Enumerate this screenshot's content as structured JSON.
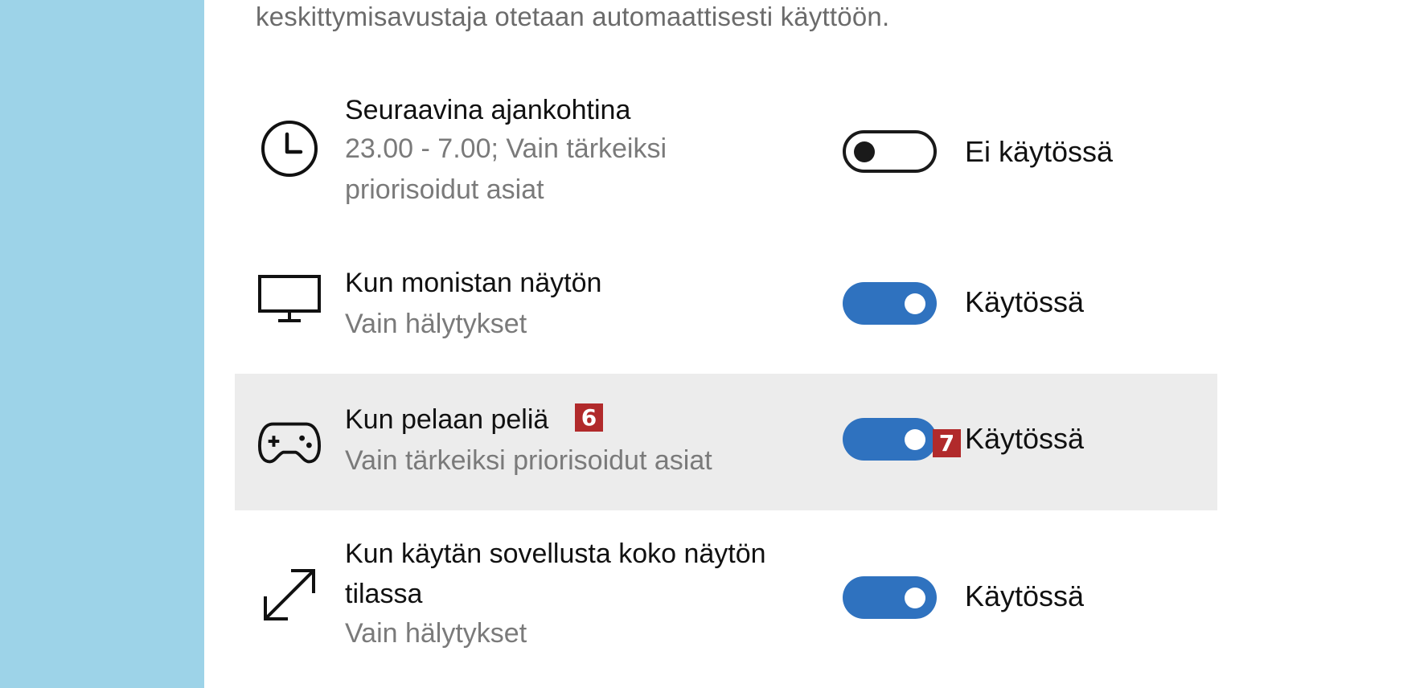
{
  "intro_text": "keskittymisavustaja otetaan automaattisesti käyttöön.",
  "colors": {
    "sidebar": "#9dd3e8",
    "toggle_on": "#2f72bf",
    "row_highlight": "#ececec",
    "badge": "#b12a2b"
  },
  "rules": [
    {
      "icon": "clock-icon",
      "title": "Seuraavina ajankohtina",
      "subtitle_line1": "23.00 - 7.00; Vain tärkeiksi",
      "subtitle_line2": "priorisoidut asiat",
      "toggle_on": false,
      "toggle_label": "Ei käytössä"
    },
    {
      "icon": "monitor-icon",
      "title": "Kun monistan näytön",
      "subtitle": "Vain hälytykset",
      "toggle_on": true,
      "toggle_label": "Käytössä"
    },
    {
      "icon": "gamepad-icon",
      "title": "Kun pelaan peliä",
      "subtitle": "Vain tärkeiksi priorisoidut asiat",
      "toggle_on": true,
      "toggle_label": "Käytössä",
      "highlighted": true
    },
    {
      "icon": "fullscreen-arrows-icon",
      "title_line1": "Kun käytän sovellusta koko näytön",
      "title_line2": "tilassa",
      "subtitle": "Vain hälytykset",
      "toggle_on": true,
      "toggle_label": "Käytössä"
    }
  ],
  "badges": {
    "title_badge": "6",
    "toggle_badge": "7"
  }
}
